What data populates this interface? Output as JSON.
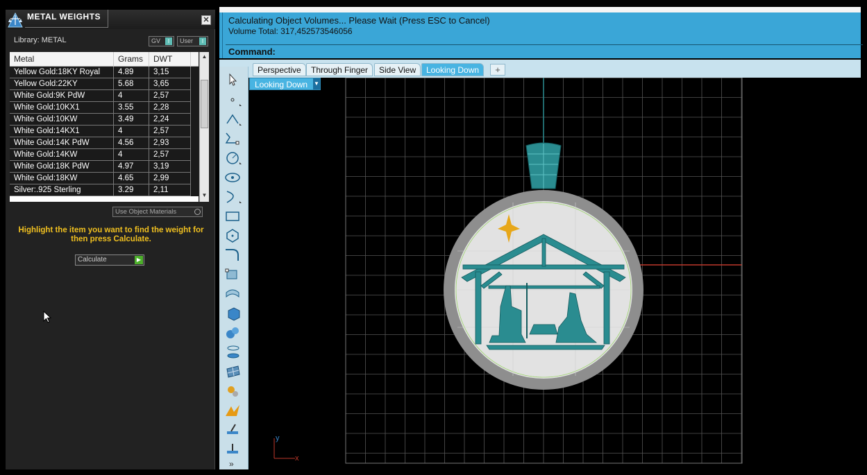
{
  "panel": {
    "title": "METAL WEIGHTS",
    "close": "✕",
    "library_label": "Library: METAL",
    "toggles": [
      {
        "label": "GV",
        "state": "I"
      },
      {
        "label": "User",
        "state": "I"
      }
    ],
    "table": {
      "headers": [
        "Metal",
        "Grams",
        "DWT"
      ],
      "rows": [
        {
          "metal": "Yellow Gold:18KY Royal",
          "grams": "4.89",
          "dwt": "3,15"
        },
        {
          "metal": "Yellow Gold:22KY",
          "grams": "5.68",
          "dwt": "3,65"
        },
        {
          "metal": "White Gold:9K PdW",
          "grams": "4",
          "dwt": "2,57"
        },
        {
          "metal": "White Gold:10KX1",
          "grams": "3.55",
          "dwt": "2,28"
        },
        {
          "metal": "White Gold:10KW",
          "grams": "3.49",
          "dwt": "2,24"
        },
        {
          "metal": "White Gold:14KX1",
          "grams": "4",
          "dwt": "2,57"
        },
        {
          "metal": "White Gold:14K PdW",
          "grams": "4.56",
          "dwt": "2,93"
        },
        {
          "metal": "White Gold:14KW",
          "grams": "4",
          "dwt": "2,57"
        },
        {
          "metal": "White Gold:18K PdW",
          "grams": "4.97",
          "dwt": "3,19"
        },
        {
          "metal": "White Gold:18KW",
          "grams": "4.65",
          "dwt": "2,99"
        },
        {
          "metal": "Silver:.925 Sterling",
          "grams": "3.29",
          "dwt": "2,11"
        }
      ]
    },
    "use_object_materials": "Use Object Materials",
    "hint": "Highlight the item you want to find the weight for then press Calculate.",
    "calculate_label": "Calculate"
  },
  "command": {
    "line1": "Calculating Object Volumes... Please Wait (Press ESC to Cancel)",
    "line2": "Volume Total: 317,452573546056",
    "prompt_label": "Command:"
  },
  "tabs": [
    {
      "label": "Perspective",
      "active": false
    },
    {
      "label": "Through Finger",
      "active": false
    },
    {
      "label": "Side View",
      "active": false
    },
    {
      "label": "Looking Down",
      "active": true
    }
  ],
  "tab_add": "+",
  "viewport": {
    "view_selector": "Looking Down",
    "axis_y": "y",
    "axis_x": "x"
  },
  "toolbar": {
    "tools": [
      "select-arrow-icon",
      "point-icon",
      "polyline-icon",
      "curve-icon",
      "circle-icon",
      "ellipse-icon",
      "arc-icon",
      "rectangle-icon",
      "polygon-icon",
      "fillet-icon",
      "transform-icon",
      "surface-icon",
      "box-icon",
      "sphere-icon",
      "cylinder-icon",
      "mesh-icon",
      "gear-icon",
      "gem-icon",
      "cut-icon",
      "dimension-icon"
    ],
    "more": "»"
  },
  "colors": {
    "command_bg": "#3aa6d7",
    "tab_active": "#48b4e2",
    "toolbar_bg": "#c9dfe9",
    "model_teal": "#2a8c90",
    "hint_text": "#f0c020"
  }
}
